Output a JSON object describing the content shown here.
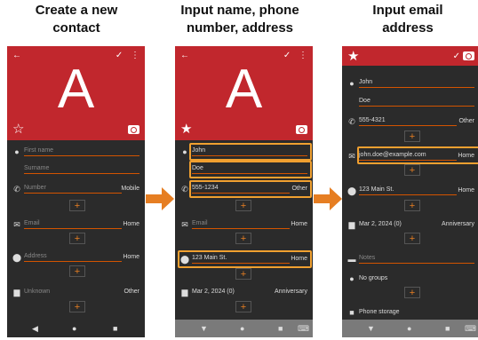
{
  "captions": {
    "c1": {
      "l1": "Create a new",
      "l2": "contact"
    },
    "c2": {
      "l1": "Input name, phone",
      "l2": "number, address"
    },
    "c3": {
      "l1": "Input email",
      "l2": "address"
    }
  },
  "avatar_letter": "A",
  "icons": {
    "back": "←",
    "save": "✓",
    "more": "⋮",
    "star_empty": "☆",
    "star_full": "★",
    "plus": "+",
    "back_nav": "◀",
    "home_nav": "●",
    "recent_nav": "■",
    "down_nav": "▼",
    "kbd_nav": "⌨"
  },
  "screen1": {
    "first_name": "First name",
    "surname": "Surname",
    "number": "Number",
    "number_type": "Mobile",
    "email": "Email",
    "email_type": "Home",
    "address": "Address",
    "address_type": "Home",
    "event": "Unknown",
    "event_type": "Other"
  },
  "screen2": {
    "first_name": "John",
    "surname": "Doe",
    "number": "555-1234",
    "number_type": "Other",
    "email": "Email",
    "email_type": "Home",
    "address": "123 Main St.",
    "address_type": "Home",
    "event": "Mar 2, 2024 (0)",
    "event_type": "Anniversary"
  },
  "screen3": {
    "first_name": "John",
    "surname": "Doe",
    "number": "555-4321",
    "number_type": "Other",
    "email": "john.doe@example.com",
    "email_type": "Home",
    "address": "123 Main St.",
    "address_type": "Home",
    "event": "Mar 2, 2024 (0)",
    "event_type": "Anniversary",
    "notes": "Notes",
    "groups": "No groups",
    "storage": "Phone storage"
  },
  "colors": {
    "header_red": "#c1272d",
    "highlight": "#f0a030",
    "arrow": "#e67e22"
  }
}
